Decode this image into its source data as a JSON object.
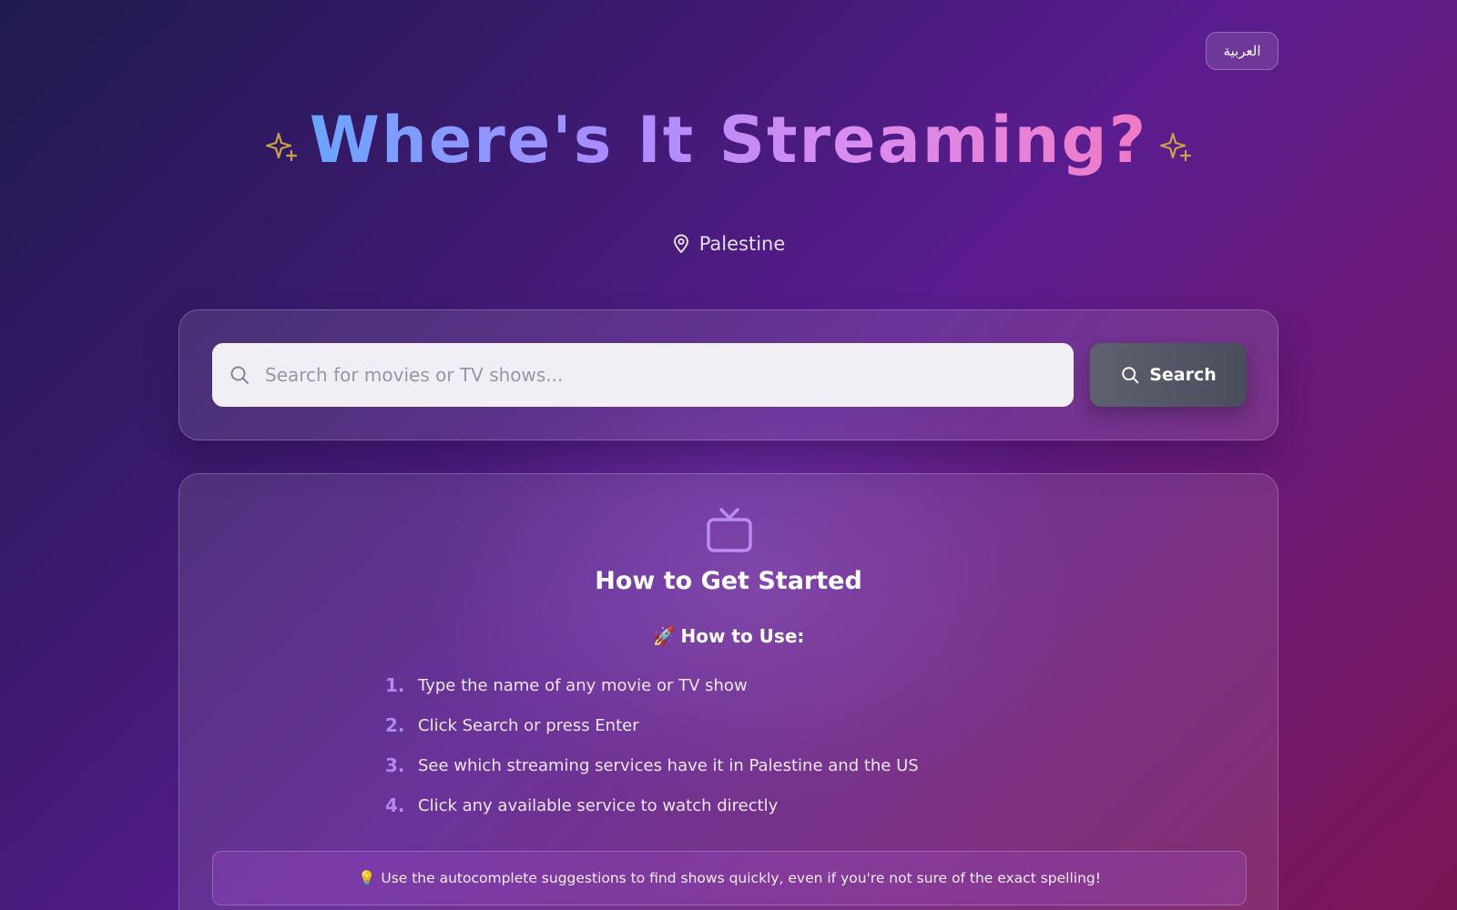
{
  "header": {
    "language_button": "العربية",
    "title": "Where's It Streaming?",
    "location": "Palestine"
  },
  "search": {
    "placeholder": "Search for movies or TV shows...",
    "button_label": "Search"
  },
  "info": {
    "title": "How to Get Started",
    "how_to_emoji": "🚀",
    "how_to_heading": "How to Use:",
    "steps": [
      {
        "num": "1.",
        "text": "Type the name of any movie or TV show"
      },
      {
        "num": "2.",
        "text": "Click Search or press Enter"
      },
      {
        "num": "3.",
        "text": "See which streaming services have it in Palestine and the US"
      },
      {
        "num": "4.",
        "text": "Click any available service to watch directly"
      }
    ],
    "tip_emoji": "💡",
    "tip": "Use the autocomplete suggestions to find shows quickly, even if you're not sure of the exact spelling!"
  },
  "icons": {
    "sparkle": "sparkle-icon",
    "location": "map-pin-icon",
    "search": "search-icon",
    "tv": "tv-icon"
  },
  "colors": {
    "sparkle": "#c8a24a",
    "step_number": "#b186f0",
    "tv_icon": "#b98cf5"
  }
}
